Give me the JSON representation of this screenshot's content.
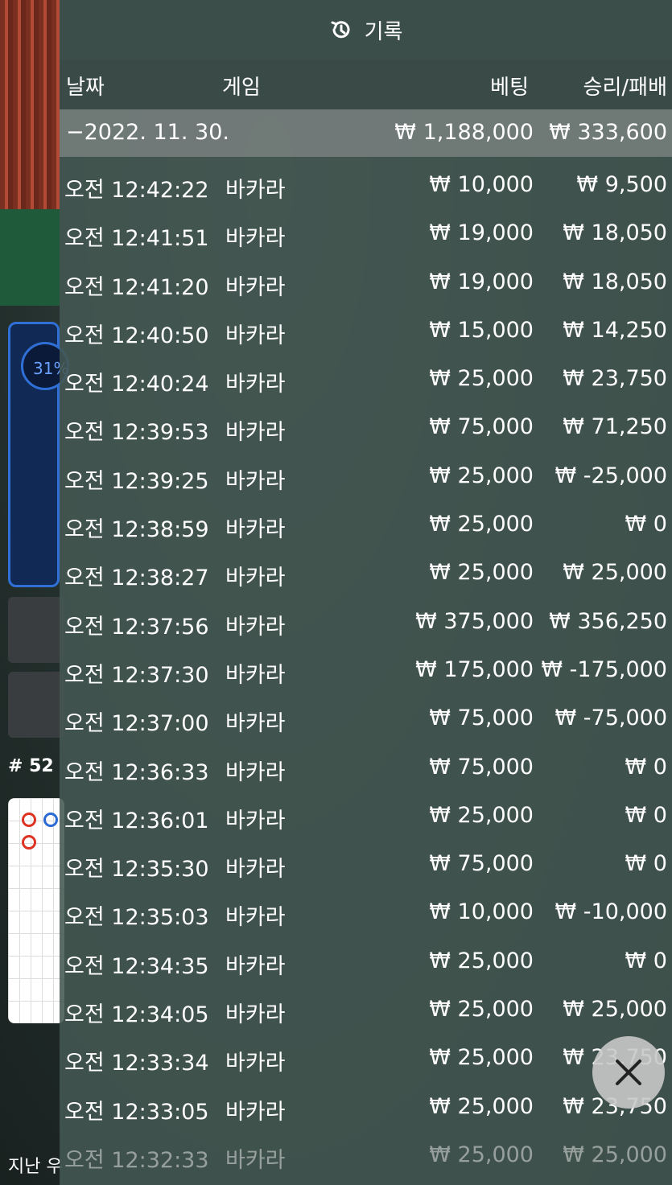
{
  "background": {
    "percent_label": "31%",
    "round_label": "# 52",
    "bottom_text": "지난 우"
  },
  "header": {
    "title": "기록",
    "icon": "history-icon"
  },
  "columns": {
    "date": "날짜",
    "game": "게임",
    "bet": "베팅",
    "win_loss": "승리/패배"
  },
  "summary": {
    "date": "−2022. 11. 30.",
    "bet": "₩ 1,188,000",
    "win_loss": "₩ 333,600"
  },
  "rows": [
    {
      "time": "오전 12:42:22",
      "game": "바카라",
      "bet": "₩ 10,000",
      "win_loss": "₩ 9,500"
    },
    {
      "time": "오전 12:41:51",
      "game": "바카라",
      "bet": "₩ 19,000",
      "win_loss": "₩ 18,050"
    },
    {
      "time": "오전 12:41:20",
      "game": "바카라",
      "bet": "₩ 19,000",
      "win_loss": "₩ 18,050"
    },
    {
      "time": "오전 12:40:50",
      "game": "바카라",
      "bet": "₩ 15,000",
      "win_loss": "₩ 14,250"
    },
    {
      "time": "오전 12:40:24",
      "game": "바카라",
      "bet": "₩ 25,000",
      "win_loss": "₩ 23,750"
    },
    {
      "time": "오전 12:39:53",
      "game": "바카라",
      "bet": "₩ 75,000",
      "win_loss": "₩ 71,250"
    },
    {
      "time": "오전 12:39:25",
      "game": "바카라",
      "bet": "₩ 25,000",
      "win_loss": "₩ -25,000"
    },
    {
      "time": "오전 12:38:59",
      "game": "바카라",
      "bet": "₩ 25,000",
      "win_loss": "₩ 0"
    },
    {
      "time": "오전 12:38:27",
      "game": "바카라",
      "bet": "₩ 25,000",
      "win_loss": "₩ 25,000"
    },
    {
      "time": "오전 12:37:56",
      "game": "바카라",
      "bet": "₩ 375,000",
      "win_loss": "₩ 356,250"
    },
    {
      "time": "오전 12:37:30",
      "game": "바카라",
      "bet": "₩ 175,000",
      "win_loss": "₩ -175,000"
    },
    {
      "time": "오전 12:37:00",
      "game": "바카라",
      "bet": "₩ 75,000",
      "win_loss": "₩ -75,000"
    },
    {
      "time": "오전 12:36:33",
      "game": "바카라",
      "bet": "₩ 75,000",
      "win_loss": "₩ 0"
    },
    {
      "time": "오전 12:36:01",
      "game": "바카라",
      "bet": "₩ 25,000",
      "win_loss": "₩ 0"
    },
    {
      "time": "오전 12:35:30",
      "game": "바카라",
      "bet": "₩ 75,000",
      "win_loss": "₩ 0"
    },
    {
      "time": "오전 12:35:03",
      "game": "바카라",
      "bet": "₩ 10,000",
      "win_loss": "₩ -10,000"
    },
    {
      "time": "오전 12:34:35",
      "game": "바카라",
      "bet": "₩ 25,000",
      "win_loss": "₩ 0"
    },
    {
      "time": "오전 12:34:05",
      "game": "바카라",
      "bet": "₩ 25,000",
      "win_loss": "₩ 25,000"
    },
    {
      "time": "오전 12:33:34",
      "game": "바카라",
      "bet": "₩ 25,000",
      "win_loss": "₩ 23,750"
    },
    {
      "time": "오전 12:33:05",
      "game": "바카라",
      "bet": "₩ 25,000",
      "win_loss": "₩ 23,750"
    },
    {
      "time": "오전 12:32:33",
      "game": "바카라",
      "bet": "₩ 25,000",
      "win_loss": "₩ 25,000"
    }
  ],
  "close_button": {
    "icon": "close-icon"
  }
}
